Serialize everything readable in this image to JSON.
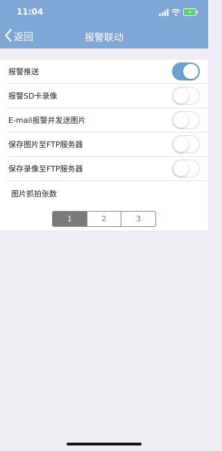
{
  "status_bar": {
    "time": "11:04"
  },
  "nav": {
    "back_label": "返回",
    "title": "报警联动"
  },
  "settings": [
    {
      "label": "报警推送",
      "on": true
    },
    {
      "label": "报警SD卡录像",
      "on": false
    },
    {
      "label": "E-mail报警并发送图片",
      "on": false
    },
    {
      "label": "保存图片至FTP服务器",
      "on": false
    },
    {
      "label": "保存录像至FTP服务器",
      "on": false
    }
  ],
  "capture_count": {
    "label": "图片抓拍张数",
    "options": [
      "1",
      "2",
      "3"
    ],
    "selected": "1"
  },
  "colors": {
    "header": "#7ea7d6",
    "toggle_on": "#6a9fd2",
    "background": "#eeedf3",
    "segment_selected": "#7a7a7a"
  }
}
